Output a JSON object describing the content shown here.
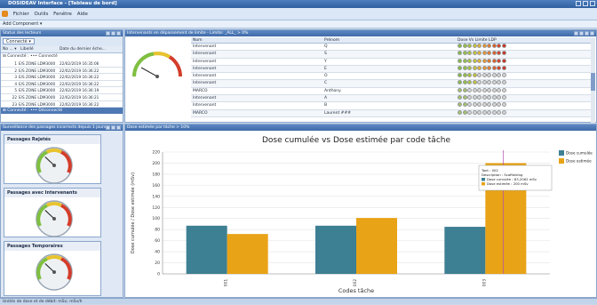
{
  "window": {
    "title": "DOSIDEAV Interface - [Tableau de bord]"
  },
  "menu": {
    "items": [
      "Fichier",
      "Outils",
      "Fenêtre",
      "Aide"
    ]
  },
  "quick_access": {
    "label": "Add Component ▾"
  },
  "readers_panel": {
    "title": "Status des lecteurs",
    "filter_value": "Connecté",
    "columns": [
      "No ... ▾",
      "Libellé",
      "Date du dernier éche..."
    ],
    "group_connected": "Connecté : ••• Connecté",
    "rows": [
      {
        "no": "1",
        "label": "E/S ZONE LDM3000",
        "date": "22/02/2019 16:35:06"
      },
      {
        "no": "2",
        "label": "E/S ZONE LDM3000",
        "date": "22/02/2019 16:36:22"
      },
      {
        "no": "3",
        "label": "E/S ZONE LDM3000",
        "date": "22/02/2019 16:36:22"
      },
      {
        "no": "4",
        "label": "E/S ZONE LDM3000",
        "date": "22/02/2019 16:36:22"
      },
      {
        "no": "5",
        "label": "E/S ZONE LDM3000",
        "date": "22/02/2019 16:36:19"
      },
      {
        "no": "22",
        "label": "E/S ZONE LDM3000",
        "date": "22/02/2019 16:36:21"
      },
      {
        "no": "23",
        "label": "E/S ZONE LDM3000",
        "date": "22/02/2019 16:36:22"
      }
    ],
    "group_disconnected": "Connecté : ••• Déconnecté"
  },
  "passages_panel": {
    "title": "Surveillance des passages incorrects depuis 1 jours",
    "gauges": [
      {
        "title": "Passages Rejetés",
        "level": 0.3
      },
      {
        "title": "Passages avec Intervenants",
        "level": 0.3
      },
      {
        "title": "Passages Temporaires",
        "level": 0.3
      }
    ]
  },
  "exceed_panel": {
    "title": "Intervenants en dépassement de limite - Limite: _ALL_ > 0%",
    "columns": [
      "Nom",
      "Prénom",
      "Dose Vs Limite LDP"
    ],
    "rows": [
      {
        "nom": "Intervenant",
        "prenom": "Q",
        "level": 6
      },
      {
        "nom": "Intervenant",
        "prenom": "S",
        "level": 6
      },
      {
        "nom": "Intervenant",
        "prenom": "Y",
        "level": 6
      },
      {
        "nom": "Intervenant",
        "prenom": "E",
        "level": 6
      },
      {
        "nom": "Intervenant",
        "prenom": "O",
        "level": 3
      },
      {
        "nom": "Intervenant",
        "prenom": "C",
        "level": 4
      },
      {
        "nom": "MARCO",
        "prenom": "Anthony",
        "level": 0
      },
      {
        "nom": "Intervenant",
        "prenom": "A",
        "level": 0
      },
      {
        "nom": "Intervenant",
        "prenom": "B",
        "level": 0
      },
      {
        "nom": "MARCO",
        "prenom": "Laurent ###",
        "level": 0
      }
    ]
  },
  "dose_panel": {
    "title": "Dose estimée par tâche > 10%"
  },
  "chart_data": {
    "type": "bar",
    "title": "Dose cumulée vs Dose estimée par code tâche",
    "xlabel": "Codes tâche",
    "ylabel": "Dose cumulée / Dose estimée (mSv)",
    "ylim": [
      0,
      220
    ],
    "yticks": [
      0,
      20,
      40,
      60,
      80,
      100,
      120,
      140,
      160,
      180,
      200,
      220
    ],
    "categories": [
      "001",
      "002",
      "003"
    ],
    "series": [
      {
        "name": "Dose cumulée",
        "color": "#3d7f93",
        "values": [
          87,
          87,
          85
        ]
      },
      {
        "name": "Dose estimée",
        "color": "#e8a317",
        "values": [
          72,
          101,
          200
        ]
      }
    ],
    "legend_position": "top-right",
    "grid": true
  },
  "tooltip": {
    "lines": [
      "Tant : 002",
      "Description : Scaffolding"
    ],
    "entries": [
      {
        "label": "Dose cumulée : 83,2062 mSv",
        "color": "#3d7f93"
      },
      {
        "label": "Dose estimée : 200 mSv",
        "color": "#e8a317"
      }
    ]
  },
  "status_bar": {
    "text": "Unités de dose et de débit: mSv; mSv/h"
  }
}
